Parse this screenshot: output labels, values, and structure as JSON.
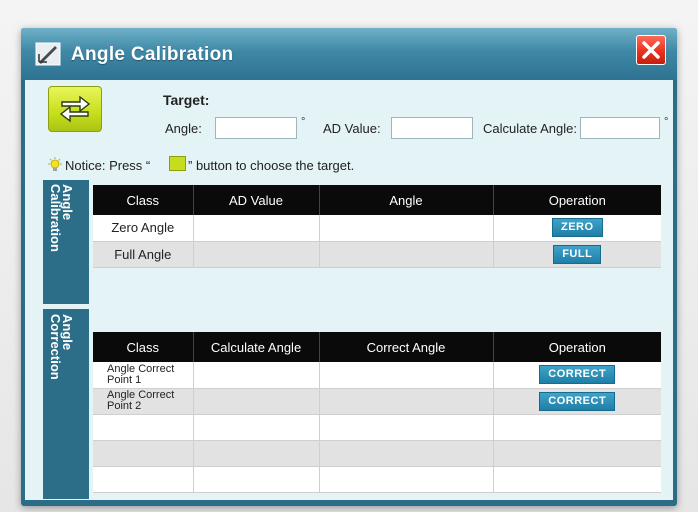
{
  "window": {
    "title": "Angle Calibration"
  },
  "target": {
    "heading": "Target:",
    "angle_label": "Angle:",
    "angle_value": "",
    "angle_unit": "°",
    "ad_label": "AD Value:",
    "ad_value": "",
    "calc_label": "Calculate Angle:",
    "calc_value": "",
    "calc_unit": "°"
  },
  "notice": {
    "prefix": "Notice: Press “",
    "suffix": "” button to choose the target."
  },
  "calibration": {
    "side_label": "Angle\nCalibration",
    "columns": [
      "Class",
      "AD Value",
      "Angle",
      "Operation"
    ],
    "rows": [
      {
        "class": "Zero Angle",
        "ad": "",
        "angle": "",
        "button": "ZERO"
      },
      {
        "class": "Full Angle",
        "ad": "",
        "angle": "",
        "button": "FULL"
      }
    ]
  },
  "correction": {
    "side_label": "Angle\nCorrection",
    "columns": [
      "Class",
      "Calculate Angle",
      "Correct Angle",
      "Operation"
    ],
    "rows": [
      {
        "class": "Angle Correct Point 1",
        "button": "CORRECT"
      },
      {
        "class": "Angle Correct Point 2",
        "button": "CORRECT"
      }
    ]
  }
}
